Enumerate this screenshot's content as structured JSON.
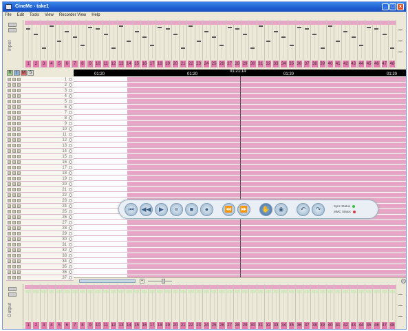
{
  "window": {
    "title": "CineMe - take1",
    "min": "_",
    "max": "□",
    "close": "x"
  },
  "menu": [
    "File",
    "Edit",
    "Tools",
    "View",
    "Recorder View",
    "Help"
  ],
  "input_strip": {
    "label": "Input"
  },
  "output_strip": {
    "label": "Output"
  },
  "channels": [
    "1",
    "2",
    "3",
    "4",
    "5",
    "6",
    "7",
    "8",
    "9",
    "10",
    "11",
    "12",
    "13",
    "14",
    "15",
    "16",
    "17",
    "18",
    "19",
    "20",
    "21",
    "22",
    "23",
    "24",
    "25",
    "26",
    "27",
    "28",
    "29",
    "30",
    "31",
    "32",
    "33",
    "34",
    "35",
    "36",
    "37",
    "38",
    "39",
    "40",
    "41",
    "42",
    "43",
    "44",
    "45",
    "46",
    "47",
    "48"
  ],
  "track_tools": [
    "R",
    "I",
    "M",
    "S"
  ],
  "tracks": [
    "1",
    "2",
    "3",
    "4",
    "5",
    "6",
    "7",
    "8",
    "9",
    "10",
    "11",
    "12",
    "13",
    "14",
    "15",
    "16",
    "17",
    "18",
    "19",
    "20",
    "21",
    "22",
    "23",
    "24",
    "25",
    "26",
    "27",
    "28",
    "29",
    "30",
    "31",
    "32",
    "33",
    "34",
    "35",
    "36",
    "37"
  ],
  "timeline": {
    "current_time": "01:21:14",
    "ruler_marks": [
      "01:20",
      "01:20",
      "01:20",
      "01:20"
    ]
  },
  "transport": {
    "buttons": [
      {
        "name": "go-to-start-icon",
        "glyph": "⏮"
      },
      {
        "name": "rewind-icon",
        "glyph": "◀◀"
      },
      {
        "name": "play-icon",
        "glyph": "▶"
      },
      {
        "name": "pause-icon",
        "glyph": "⏸"
      },
      {
        "name": "stop-icon",
        "glyph": "■"
      },
      {
        "name": "record-icon",
        "glyph": "●"
      },
      {
        "name": "prev-marker-icon",
        "glyph": "⏪"
      },
      {
        "name": "next-marker-icon",
        "glyph": "⏩"
      },
      {
        "name": "hand-icon",
        "glyph": "✋"
      },
      {
        "name": "loop-icon",
        "glyph": "◉"
      },
      {
        "name": "undo-icon",
        "glyph": "↶"
      },
      {
        "name": "redo-icon",
        "glyph": "↷"
      }
    ],
    "sync_status_label": "Sync Status",
    "mmc_status_label": "MMC Status"
  },
  "colors": {
    "clip": "#e7a6c5",
    "channel": "#e47aab",
    "sync_led": "#3bbf3b",
    "mmc_led": "#d23a3a"
  }
}
